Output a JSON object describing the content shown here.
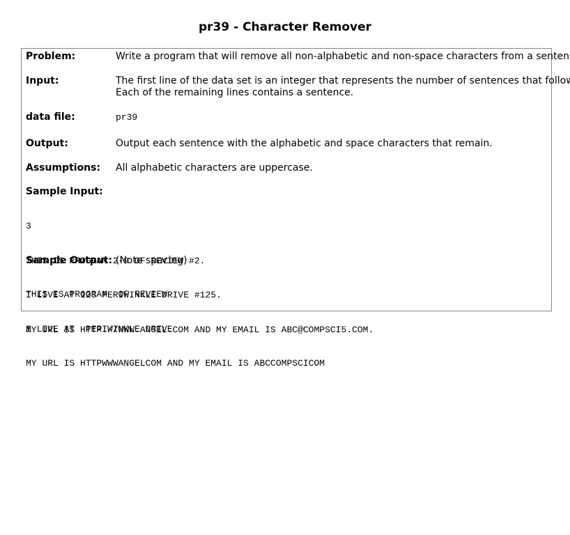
{
  "title": "pr39 - Character Remover",
  "rows": {
    "problem": {
      "label": "Problem:",
      "text": "Write a program that will remove all non-alphabetic and non-space characters from a sentence."
    },
    "input": {
      "label": "Input:",
      "line1": "The first line of the data set is an integer that represents the number of sentences that follow.",
      "line2": "Each of the remaining lines contains a sentence."
    },
    "datafile": {
      "label": "data file:",
      "text": "pr39"
    },
    "output": {
      "label": "Output:",
      "text": "Output each sentence with the alphabetic and space characters that remain."
    },
    "assumptions": {
      "label": "Assumptions:",
      "text": "All alphabetic characters are uppercase."
    }
  },
  "sample_input": {
    "label": "Sample Input:",
    "lines": [
      "3",
      "THIS IS PROGRAM 2-9 OF REVIEW #2.",
      "I LIVE AT 123 PERIWINKLE DRIVE #125.",
      "MY URL IS HTTP://WWW.ANGEL.COM AND MY EMAIL IS ABC@COMPSCI5.COM."
    ]
  },
  "sample_output": {
    "label": "Sample Output:",
    "note": "(Note spacing)",
    "lines": [
      "THIS IS PROGRAM  OF REVIEW",
      "I LIVE AT  PERIWINKLE DRIVE",
      "MY URL IS HTTPWWWANGELCOM AND MY EMAIL IS ABCCOMPSCICOM"
    ]
  }
}
